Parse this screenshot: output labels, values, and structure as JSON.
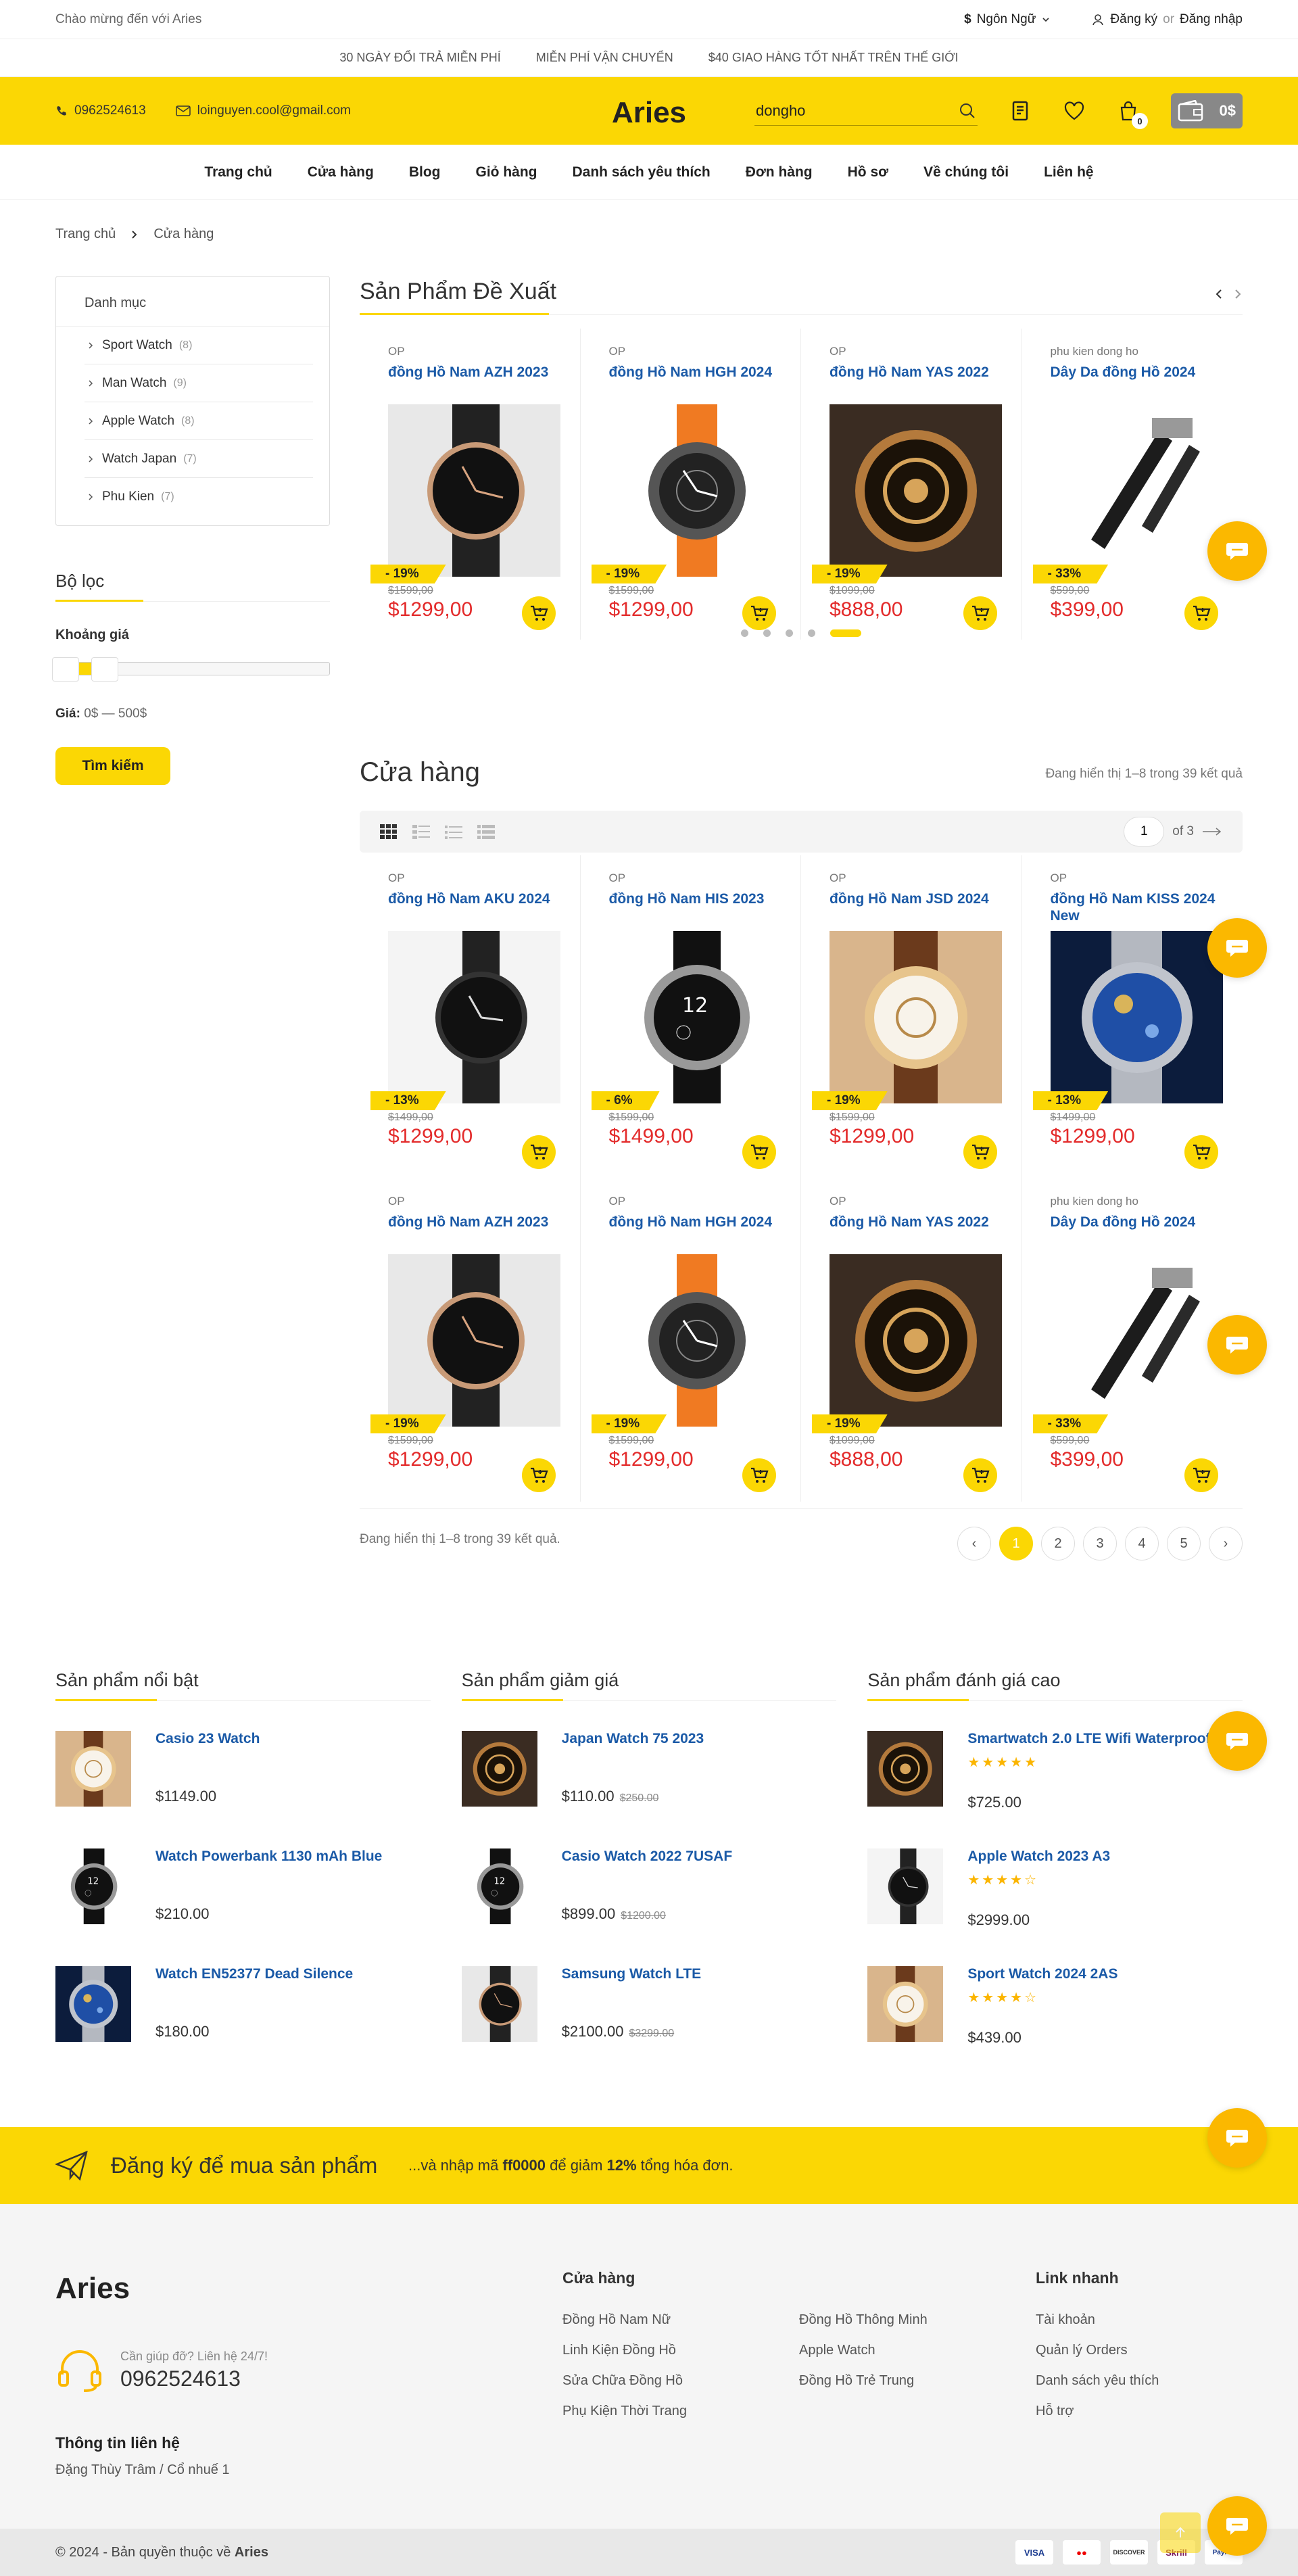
{
  "topbar": {
    "welcome": "Chào mừng đến với Aries",
    "language_symbol": "$",
    "language": "Ngôn Ngữ",
    "register": "Đăng ký",
    "or": "or",
    "login": "Đăng nhập"
  },
  "notices": [
    "30 NGÀY ĐỔI TRẢ MIỄN PHÍ",
    "MIỄN PHÍ VẬN CHUYỂN",
    "$40 GIAO HÀNG TỐT NHẤT TRÊN THẾ GIỚI"
  ],
  "header": {
    "phone": "0962524613",
    "email": "loinguyen.cool@gmail.com",
    "logo": "Aries",
    "search_value": "dongho",
    "cart_count": "0",
    "cart_total": "0$"
  },
  "nav": [
    "Trang chủ",
    "Cửa hàng",
    "Blog",
    "Giỏ hàng",
    "Danh sách yêu thích",
    "Đơn hàng",
    "Hồ sơ",
    "Về chúng tôi",
    "Liên hệ"
  ],
  "breadcrumb": {
    "home": "Trang chủ",
    "current": "Cửa hàng"
  },
  "sidebar": {
    "category_title": "Danh mục",
    "categories": [
      {
        "name": "Sport Watch",
        "count": "(8)"
      },
      {
        "name": "Man Watch",
        "count": "(9)"
      },
      {
        "name": "Apple Watch",
        "count": "(8)"
      },
      {
        "name": "Watch Japan",
        "count": "(7)"
      },
      {
        "name": "Phu Kien",
        "count": "(7)"
      }
    ],
    "filter_title": "Bộ lọc",
    "price_range_label": "Khoảng giá",
    "price_label": "Giá:",
    "price_value": "0$ — 500$",
    "search_button": "Tìm kiếm"
  },
  "featured": {
    "title": "Sản Phẩm Đề Xuất",
    "products": [
      {
        "cat": "OP",
        "name": "đồng Hồ Nam AZH 2023",
        "discount": "- 19%",
        "old": "$1599,00",
        "price": "$1299,00"
      },
      {
        "cat": "OP",
        "name": "đồng Hồ Nam HGH 2024",
        "discount": "- 19%",
        "old": "$1599,00",
        "price": "$1299,00"
      },
      {
        "cat": "OP",
        "name": "đồng Hồ Nam YAS 2022",
        "discount": "- 19%",
        "old": "$1099,00",
        "price": "$888,00"
      },
      {
        "cat": "phu kien dong ho",
        "name": "Dây Da đồng Hồ 2024",
        "discount": "- 33%",
        "old": "$599,00",
        "price": "$399,00"
      }
    ]
  },
  "shop": {
    "title": "Cửa hàng",
    "result": "Đang hiển thị 1–8 trong 39 kết quả",
    "page_input": "1",
    "page_of": "of 3",
    "products": [
      {
        "cat": "OP",
        "name": "đồng Hồ Nam AKU 2024",
        "discount": "- 13%",
        "old": "$1499,00",
        "price": "$1299,00"
      },
      {
        "cat": "OP",
        "name": "đồng Hồ Nam HIS 2023",
        "discount": "- 6%",
        "old": "$1599,00",
        "price": "$1499,00"
      },
      {
        "cat": "OP",
        "name": "đồng Hồ Nam JSD 2024",
        "discount": "- 19%",
        "old": "$1599,00",
        "price": "$1299,00"
      },
      {
        "cat": "OP",
        "name": "đồng Hồ Nam KISS 2024 New",
        "discount": "- 13%",
        "old": "$1499,00",
        "price": "$1299,00"
      },
      {
        "cat": "OP",
        "name": "đồng Hồ Nam AZH 2023",
        "discount": "- 19%",
        "old": "$1599,00",
        "price": "$1299,00"
      },
      {
        "cat": "OP",
        "name": "đồng Hồ Nam HGH 2024",
        "discount": "- 19%",
        "old": "$1599,00",
        "price": "$1299,00"
      },
      {
        "cat": "OP",
        "name": "đồng Hồ Nam YAS 2022",
        "discount": "- 19%",
        "old": "$1099,00",
        "price": "$888,00"
      },
      {
        "cat": "phu kien dong ho",
        "name": "Dây Da đồng Hồ 2024",
        "discount": "- 33%",
        "old": "$599,00",
        "price": "$399,00"
      }
    ],
    "result_bottom": "Đang hiển thị 1–8 trong 39 kết quả.",
    "pages": [
      "‹",
      "1",
      "2",
      "3",
      "4",
      "5",
      "›"
    ]
  },
  "widgets": [
    {
      "title": "Sản phẩm nổi bật",
      "items": [
        {
          "name": "Casio 23 Watch",
          "price": "$1149.00",
          "old": ""
        },
        {
          "name": "Watch Powerbank 1130 mAh Blue",
          "price": "$210.00",
          "old": ""
        },
        {
          "name": "Watch EN52377 Dead Silence",
          "price": "$180.00",
          "old": ""
        }
      ]
    },
    {
      "title": "Sản phẩm giảm giá",
      "items": [
        {
          "name": "Japan Watch 75 2023",
          "price": "$110.00",
          "old": "$250.00"
        },
        {
          "name": "Casio Watch 2022 7USAF",
          "price": "$899.00",
          "old": "$1200.00"
        },
        {
          "name": "Samsung Watch LTE",
          "price": "$2100.00",
          "old": "$3299.00"
        }
      ]
    },
    {
      "title": "Sản phẩm đánh giá cao",
      "items": [
        {
          "name": "Smartwatch 2.0 LTE Wifi Waterproof",
          "price": "$725.00",
          "stars": "★★★★★"
        },
        {
          "name": "Apple Watch 2023 A3",
          "price": "$2999.00",
          "stars": "★★★★☆"
        },
        {
          "name": "Sport Watch 2024 2AS",
          "price": "$439.00",
          "stars": "★★★★☆"
        }
      ]
    }
  ],
  "newsletter": {
    "title": "Đăng ký để mua sản phẩm",
    "text_pre": "...và nhập mã ",
    "code": "ff0000",
    "text_mid": " để giảm ",
    "percent": "12%",
    "text_post": " tổng hóa đơn."
  },
  "footer": {
    "brand": "Aries",
    "help_small": "Cần giúp đỡ? Liên hệ 24/7!",
    "help_phone": "0962524613",
    "info_title": "Thông tin liên hệ",
    "address": "Đặng Thùy Trâm / Cổ nhuế 1",
    "shop_title": "Cửa hàng",
    "shop_col1": [
      "Đồng Hồ Nam Nữ",
      "Linh Kiện Đồng Hồ",
      "Sửa Chữa Đồng Hồ",
      "Phụ Kiện Thời Trang"
    ],
    "shop_col2": [
      "Đồng Hồ Thông Minh",
      "Apple Watch",
      "Đồng Hồ Trẻ Trung"
    ],
    "quick_title": "Link nhanh",
    "quick_links": [
      "Tài khoản",
      "Quản lý Orders",
      "Danh sách yêu thích",
      "Hỗ trợ"
    ],
    "copyright_pre": "© 2024 - Bản quyền thuộc về ",
    "copyright_brand": "Aries",
    "payments": [
      "VISA",
      "MC",
      "DISCOVER",
      "Skrill",
      "PayPal"
    ]
  },
  "colors": {
    "accent": "#fbd704",
    "price": "#e32b2b",
    "link": "#1b5aa7",
    "chat": "#fbb800"
  }
}
